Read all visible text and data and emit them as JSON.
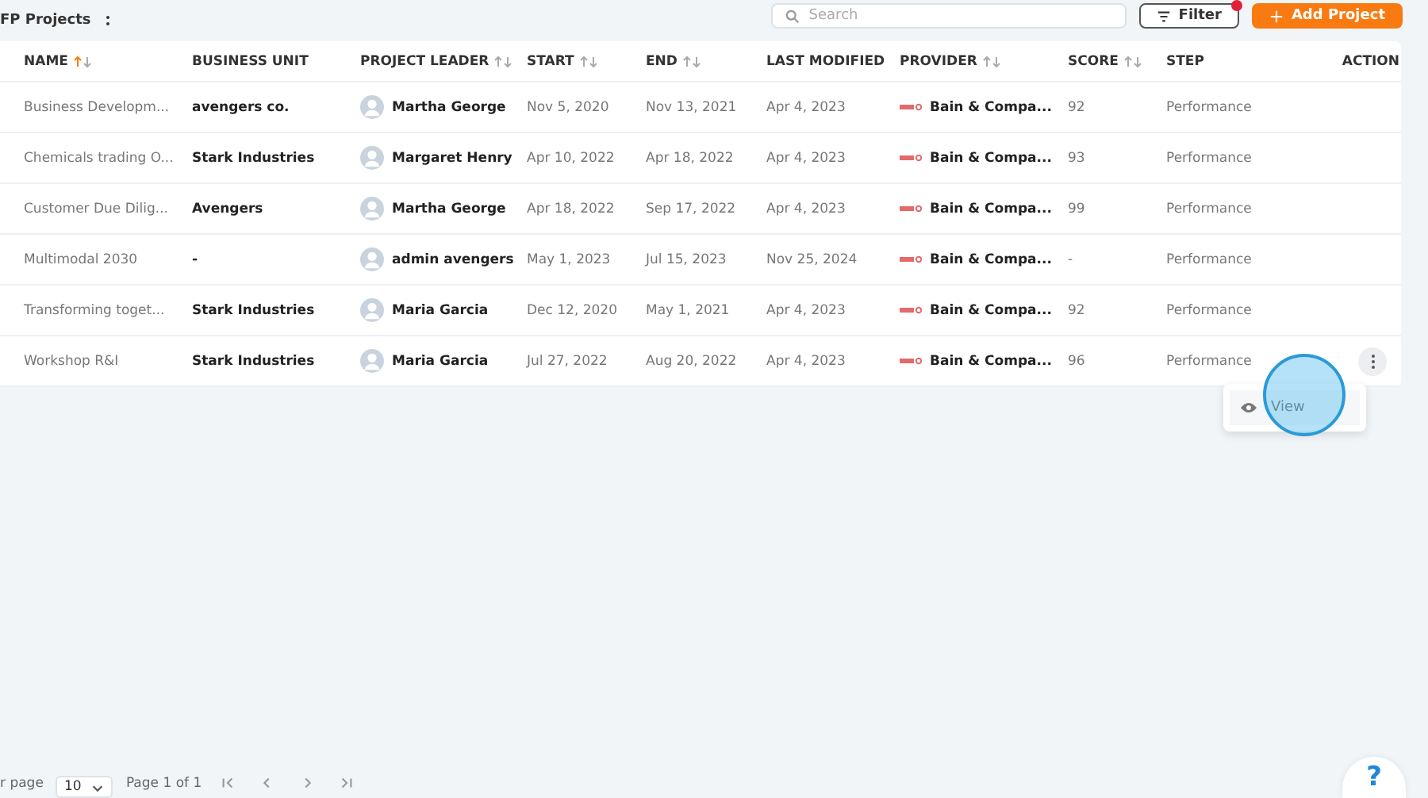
{
  "header": {
    "title": "FP Projects",
    "search": {
      "placeholder": "Search"
    },
    "filter_button": {
      "label": "Filter",
      "has_badge": true
    },
    "add_button": {
      "label": "Add Project"
    }
  },
  "table": {
    "columns": [
      {
        "label": "NAME",
        "sortable": true,
        "sorted_ascending": true
      },
      {
        "label": "BUSINESS UNIT",
        "sortable": false
      },
      {
        "label": "PROJECT LEADER",
        "sortable": true,
        "sorted_ascending": false
      },
      {
        "label": "START",
        "sortable": true,
        "sorted_ascending": false
      },
      {
        "label": "END",
        "sortable": true,
        "sorted_ascending": false
      },
      {
        "label": "LAST MODIFIED",
        "sortable": false
      },
      {
        "label": "PROVIDER",
        "sortable": true,
        "sorted_ascending": false
      },
      {
        "label": "SCORE",
        "sortable": true,
        "sorted_ascending": false
      },
      {
        "label": "STEP",
        "sortable": false
      },
      {
        "label": "ACTION",
        "sortable": false
      }
    ],
    "rows": [
      {
        "name": "Business Developm...",
        "business_unit": "avengers co.",
        "leader": "Martha George",
        "start": "Nov 5, 2020",
        "end": "Nov 13, 2021",
        "last_modified": "Apr 4, 2023",
        "provider": "Bain & Compa...",
        "score": "92",
        "step": "Performance",
        "menu_open": false
      },
      {
        "name": "Chemicals trading O...",
        "business_unit": "Stark Industries",
        "leader": "Margaret Henry",
        "start": "Apr 10, 2022",
        "end": "Apr 18, 2022",
        "last_modified": "Apr 4, 2023",
        "provider": "Bain & Compa...",
        "score": "93",
        "step": "Performance",
        "menu_open": false
      },
      {
        "name": "Customer Due Dilig...",
        "business_unit": "Avengers",
        "leader": "Martha George",
        "start": "Apr 18, 2022",
        "end": "Sep 17, 2022",
        "last_modified": "Apr 4, 2023",
        "provider": "Bain & Compa...",
        "score": "99",
        "step": "Performance",
        "menu_open": false
      },
      {
        "name": "Multimodal 2030",
        "business_unit": "-",
        "leader": "admin avengers",
        "start": "May 1, 2023",
        "end": "Jul 15, 2023",
        "last_modified": "Nov 25, 2024",
        "provider": "Bain & Compa...",
        "score": "-",
        "step": "Performance",
        "menu_open": false
      },
      {
        "name": "Transforming toget...",
        "business_unit": "Stark Industries",
        "leader": "Maria Garcia",
        "start": "Dec 12, 2020",
        "end": "May 1, 2021",
        "last_modified": "Apr 4, 2023",
        "provider": "Bain & Compa...",
        "score": "92",
        "step": "Performance",
        "menu_open": false
      },
      {
        "name": "Workshop R&I",
        "business_unit": "Stark Industries",
        "leader": "Maria Garcia",
        "start": "Jul 27, 2022",
        "end": "Aug 20, 2022",
        "last_modified": "Apr 4, 2023",
        "provider": "Bain & Compa...",
        "score": "96",
        "step": "Performance",
        "menu_open": true
      }
    ],
    "row_menu": {
      "items": [
        "View"
      ]
    }
  },
  "pagination": {
    "per_page_label": "r page",
    "per_page": "10",
    "page_info": "Page 1 of 1"
  },
  "help_button": {
    "label": "?"
  }
}
